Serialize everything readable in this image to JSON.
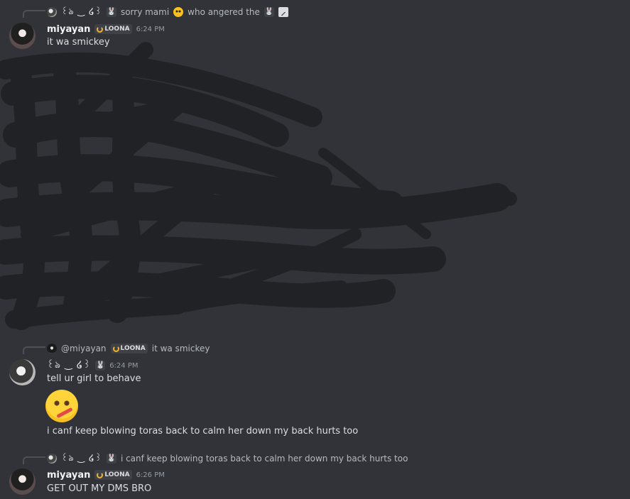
{
  "messages": [
    {
      "reply": {
        "author": "꒰ঌ ‿ ໒꒱",
        "text": "sorry mami",
        "text_after": "who angered the"
      },
      "author": "miyayan",
      "tag": "LOONA",
      "time": "6:24 PM",
      "content": "it wa smickey"
    },
    {
      "reply": {
        "author": "@miyayan",
        "tag": "LOONA",
        "text": "it wa smickey"
      },
      "author": "꒰ঌ ‿ ໒꒱",
      "time": "6:24 PM",
      "content": "tell ur girl to behave",
      "content_2": "i canf keep blowing toras back to calm her down my back hurts too"
    },
    {
      "reply": {
        "author": "꒰ঌ ‿ ໒꒱",
        "text": "i canf keep blowing toras back to calm her down my back hurts too"
      },
      "author": "miyayan",
      "tag": "LOONA",
      "time": "6:26 PM",
      "content": "GET OUT MY DMS BRO"
    }
  ],
  "icons": {
    "rabbit": "rabbit-emoji",
    "flushed": "flushed-emoji",
    "image": "image-icon",
    "thermometer_face": "face-with-thermometer-emoji"
  }
}
